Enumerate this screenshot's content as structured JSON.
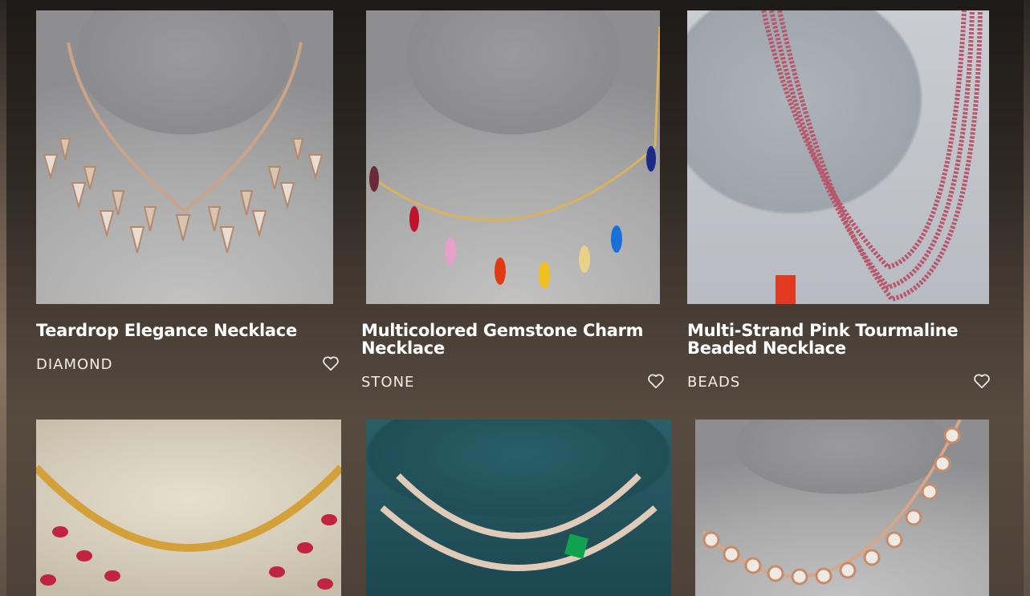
{
  "products": [
    {
      "title": "Teardrop Elegance Necklace",
      "category": "DIAMOND",
      "image": "diamond-teardrop-necklace-photo",
      "wishlist_icon": "heart-outline-icon"
    },
    {
      "title": "Multicolored Gemstone Charm Necklace",
      "category": "STONE",
      "image": "multicolor-gemstone-charm-necklace-photo",
      "wishlist_icon": "heart-outline-icon"
    },
    {
      "title": "Multi-Strand Pink Tourmaline Beaded Necklace",
      "category": "BEADS",
      "image": "pink-tourmaline-beaded-necklace-photo",
      "wishlist_icon": "heart-outline-icon"
    },
    {
      "image": "ruby-cluster-necklace-photo"
    },
    {
      "image": "emerald-diamond-choker-photo"
    },
    {
      "image": "rose-gold-diamond-halo-necklace-photo"
    }
  ],
  "colors": {
    "background_top": "#1e1a17",
    "background_bottom": "#574a3f",
    "text": "#ffffff"
  }
}
